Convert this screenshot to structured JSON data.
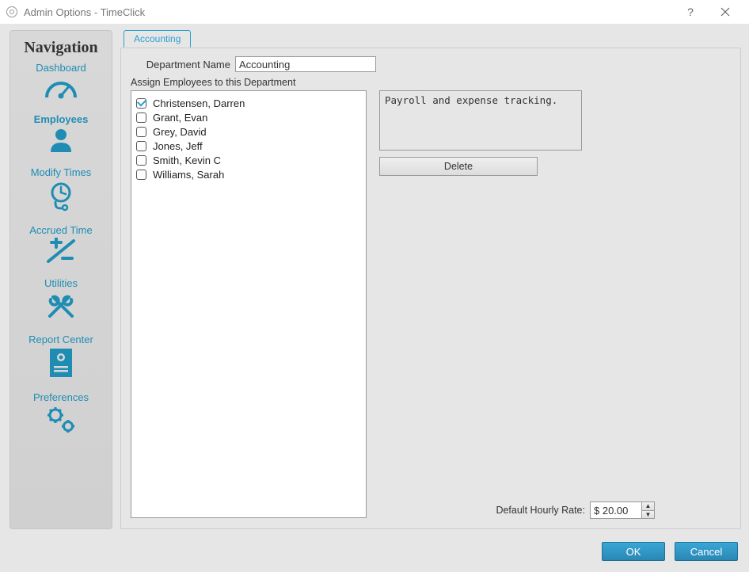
{
  "window": {
    "title": "Admin Options - TimeClick"
  },
  "sidebar": {
    "heading": "Navigation",
    "items": [
      {
        "id": "dashboard",
        "label": "Dashboard",
        "active": false
      },
      {
        "id": "employees",
        "label": "Employees",
        "active": true
      },
      {
        "id": "modify-times",
        "label": "Modify Times",
        "active": false
      },
      {
        "id": "accrued-time",
        "label": "Accrued Time",
        "active": false
      },
      {
        "id": "utilities",
        "label": "Utilities",
        "active": false
      },
      {
        "id": "report-center",
        "label": "Report Center",
        "active": false
      },
      {
        "id": "preferences",
        "label": "Preferences",
        "active": false
      }
    ]
  },
  "tabs": [
    {
      "id": "accounting",
      "label": "Accounting",
      "active": true
    }
  ],
  "form": {
    "department_name_label": "Department Name",
    "department_name_value": "Accounting",
    "assign_label": "Assign Employees to this Department",
    "description": "Payroll and expense tracking.",
    "delete_label": "Delete",
    "rate_label": "Default Hourly Rate:",
    "rate_value": "$ 20.00"
  },
  "employees": [
    {
      "name": "Christensen, Darren",
      "checked": true
    },
    {
      "name": "Grant, Evan",
      "checked": false
    },
    {
      "name": "Grey, David",
      "checked": false
    },
    {
      "name": "Jones, Jeff",
      "checked": false
    },
    {
      "name": "Smith, Kevin C",
      "checked": false
    },
    {
      "name": "Williams, Sarah",
      "checked": false
    }
  ],
  "footer": {
    "ok_label": "OK",
    "cancel_label": "Cancel"
  },
  "colors": {
    "accent": "#2d9fd0",
    "primary_button": "#2f93c1"
  }
}
